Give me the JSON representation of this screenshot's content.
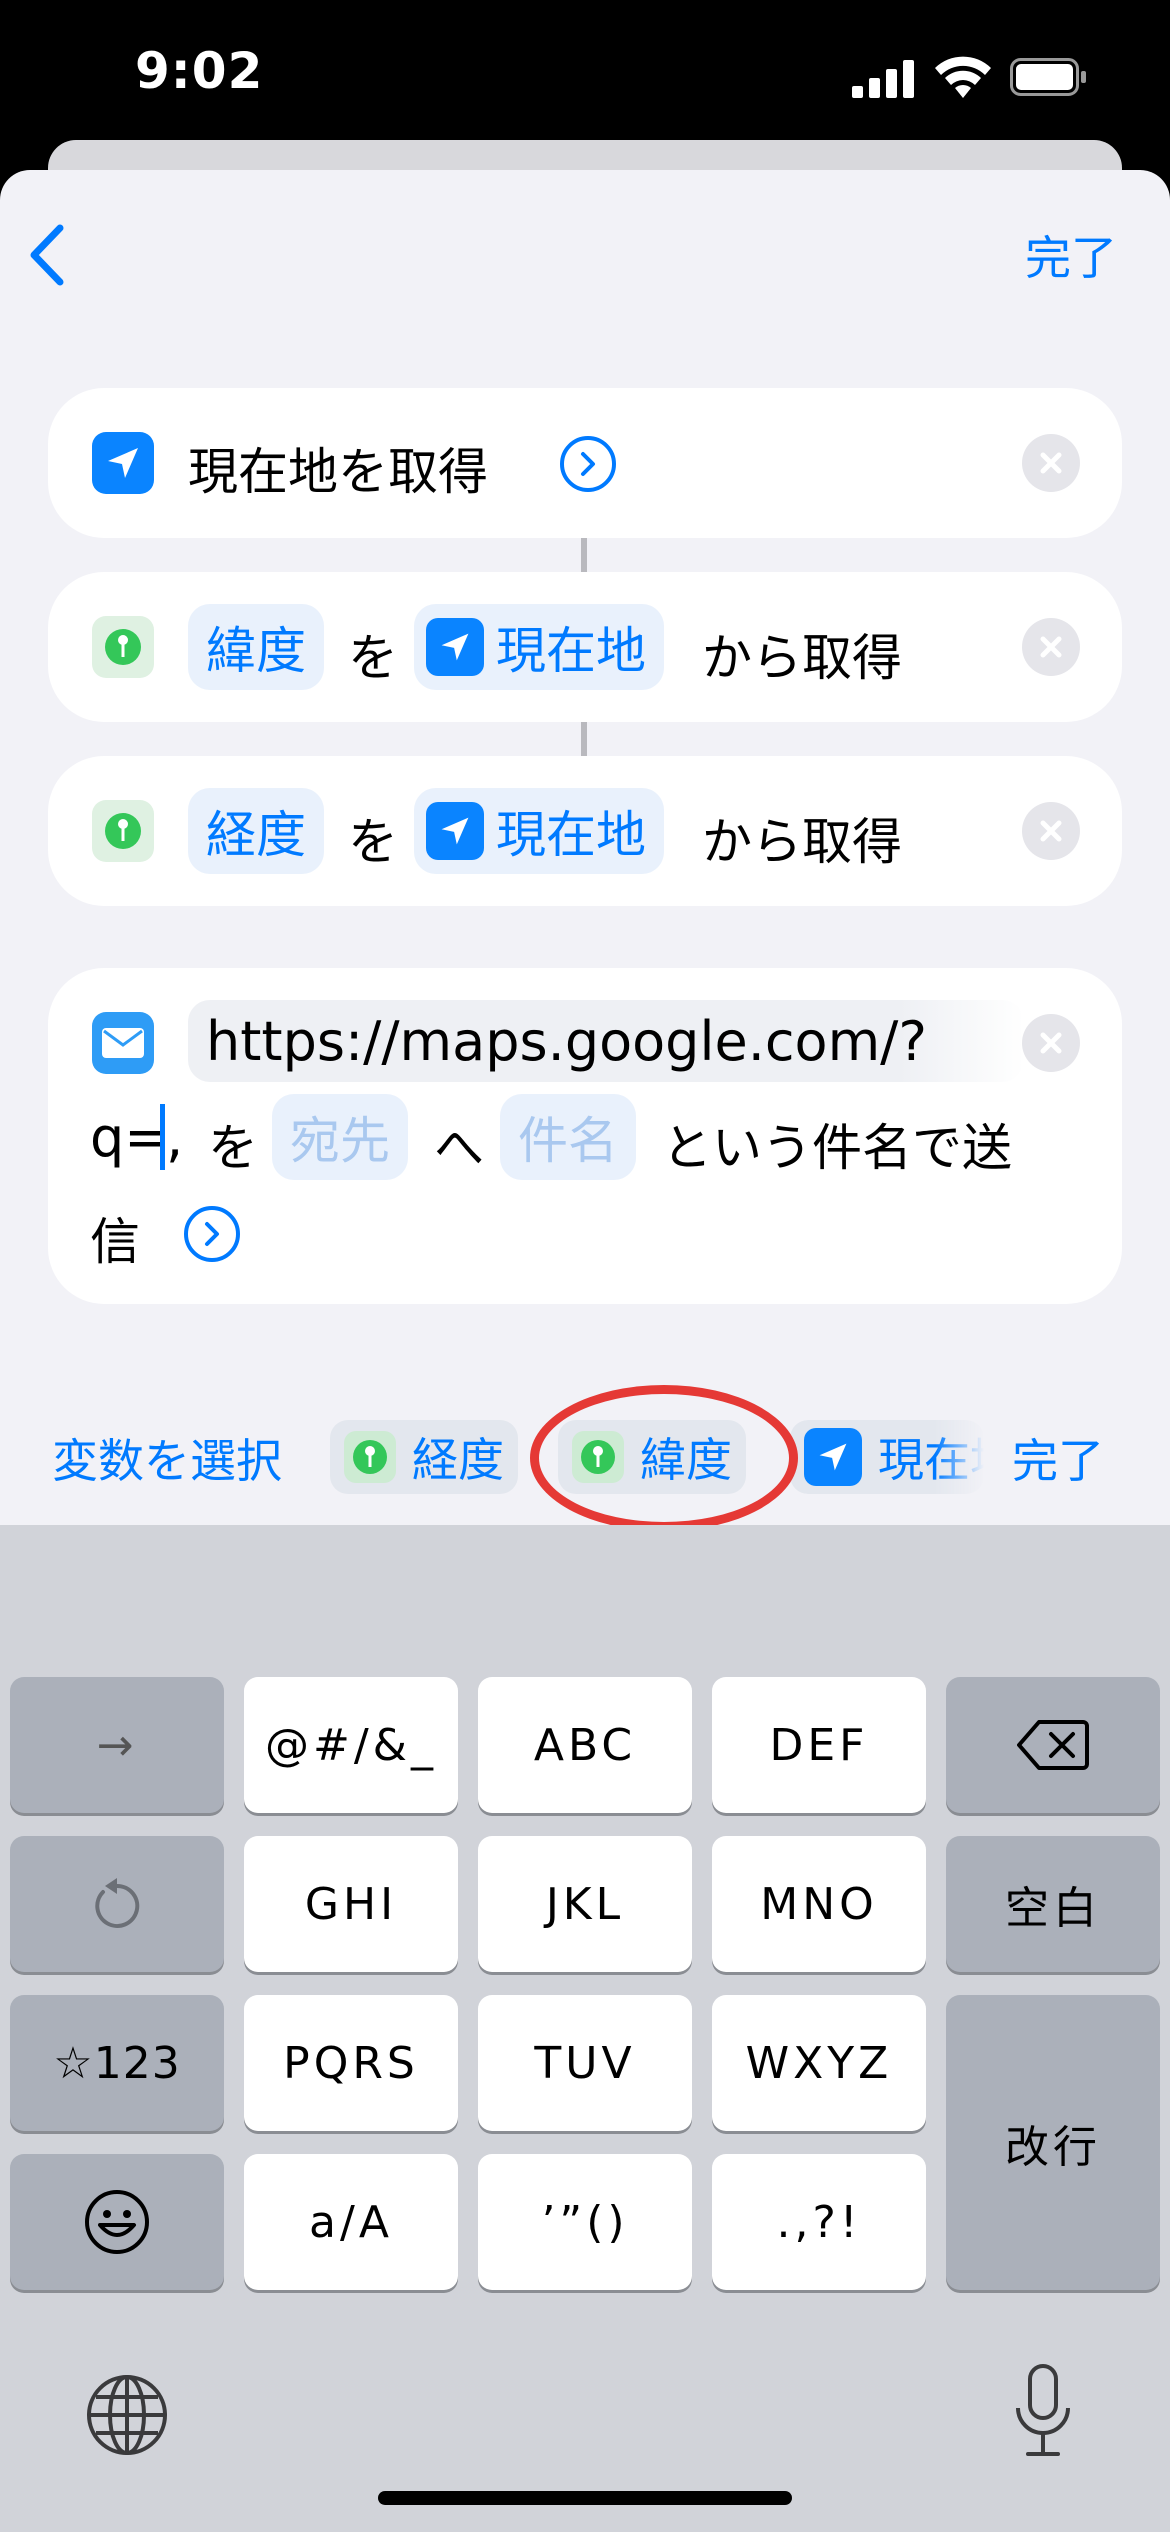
{
  "status": {
    "time": "9:02"
  },
  "nav": {
    "done": "完了"
  },
  "actions": [
    {
      "icon": "location-arrow-icon",
      "title": "現在地を取得"
    },
    {
      "var": "緯度",
      "particle": "を",
      "source": "現在地",
      "suffix": "から取得"
    },
    {
      "var": "経度",
      "particle": "を",
      "source": "現在地",
      "suffix": "から取得"
    }
  ],
  "mail": {
    "url": "https://maps.google.com/?",
    "line2_prefix": "q=",
    "line2_comma": ",",
    "particle": "を",
    "to_placeholder": "宛先",
    "to_particle": "へ",
    "subject_placeholder": "件名",
    "rest": "という件名で送",
    "line3": "信"
  },
  "varbar": {
    "label": "変数を選択",
    "chips": [
      "経度",
      "緯度",
      "現在地"
    ],
    "done": "完了"
  },
  "keyboard": {
    "row1": [
      "→",
      "@#/&_",
      "ABC",
      "DEF"
    ],
    "row2": [
      "GHI",
      "JKL",
      "MNO",
      "空白"
    ],
    "row3": [
      "☆123",
      "PQRS",
      "TUV",
      "WXYZ"
    ],
    "row4": [
      "a/A",
      "’”()",
      ".,?!"
    ],
    "return": "改行"
  },
  "colors": {
    "accent": "#007aff",
    "highlight_circle": "#e53935"
  }
}
